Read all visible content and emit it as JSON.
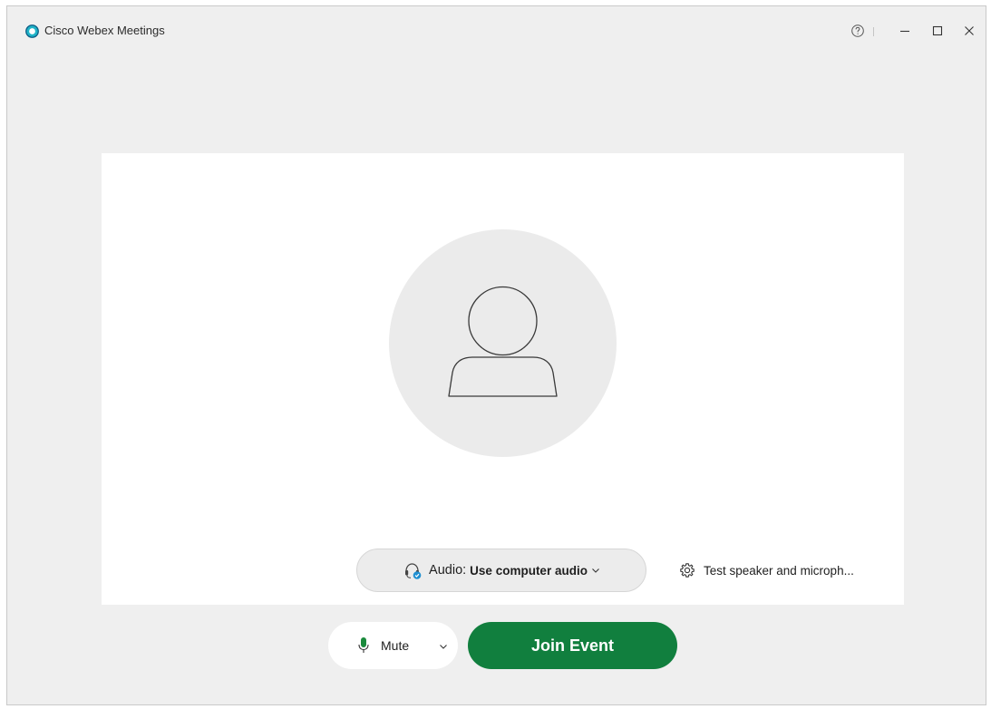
{
  "window": {
    "title": "Cisco Webex Meetings",
    "icons": {
      "logo": "webex-logo-icon",
      "help": "help-icon",
      "minimize": "minimize-icon",
      "maximize": "maximize-icon",
      "close": "close-icon"
    }
  },
  "preview": {
    "avatar": "user-avatar-icon",
    "audio": {
      "label": "Audio:",
      "value": "Use computer audio",
      "icon": "headset-icon"
    },
    "test_speaker": {
      "label": "Test speaker and microph...",
      "icon": "gear-icon"
    }
  },
  "controls": {
    "mute": {
      "label": "Mute",
      "icon": "microphone-icon"
    },
    "join_label": "Join Event"
  },
  "colors": {
    "join_button": "#117f3e",
    "mic_green": "#1a8a3c",
    "logo_teal": "#1fb3c7"
  }
}
